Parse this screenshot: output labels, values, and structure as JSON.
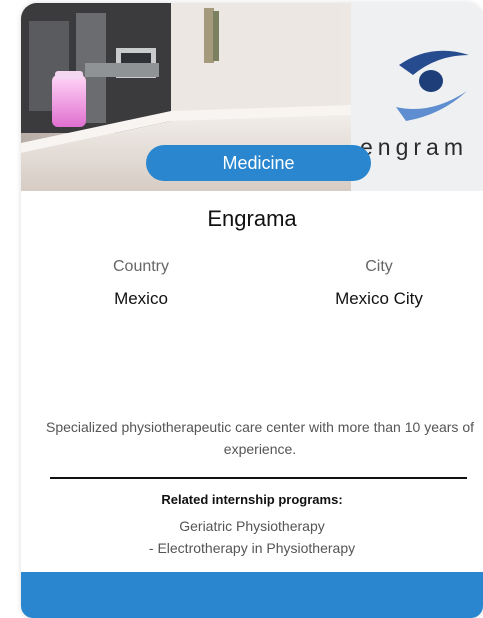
{
  "card": {
    "category": "Medicine",
    "title": "Engrama",
    "photo_text": "engram",
    "country_label": "Country",
    "country_value": "Mexico",
    "city_label": "City",
    "city_value": "Mexico City",
    "description": "Specialized physiotherapeutic care center with more than 10 years of experience.",
    "related_title": "Related internship programs:",
    "programs": [
      "Geriatric Physiotherapy",
      "- Electrotherapy in Physiotherapy"
    ]
  },
  "colors": {
    "accent": "#2a87cf",
    "footer": "#2a87cf"
  }
}
